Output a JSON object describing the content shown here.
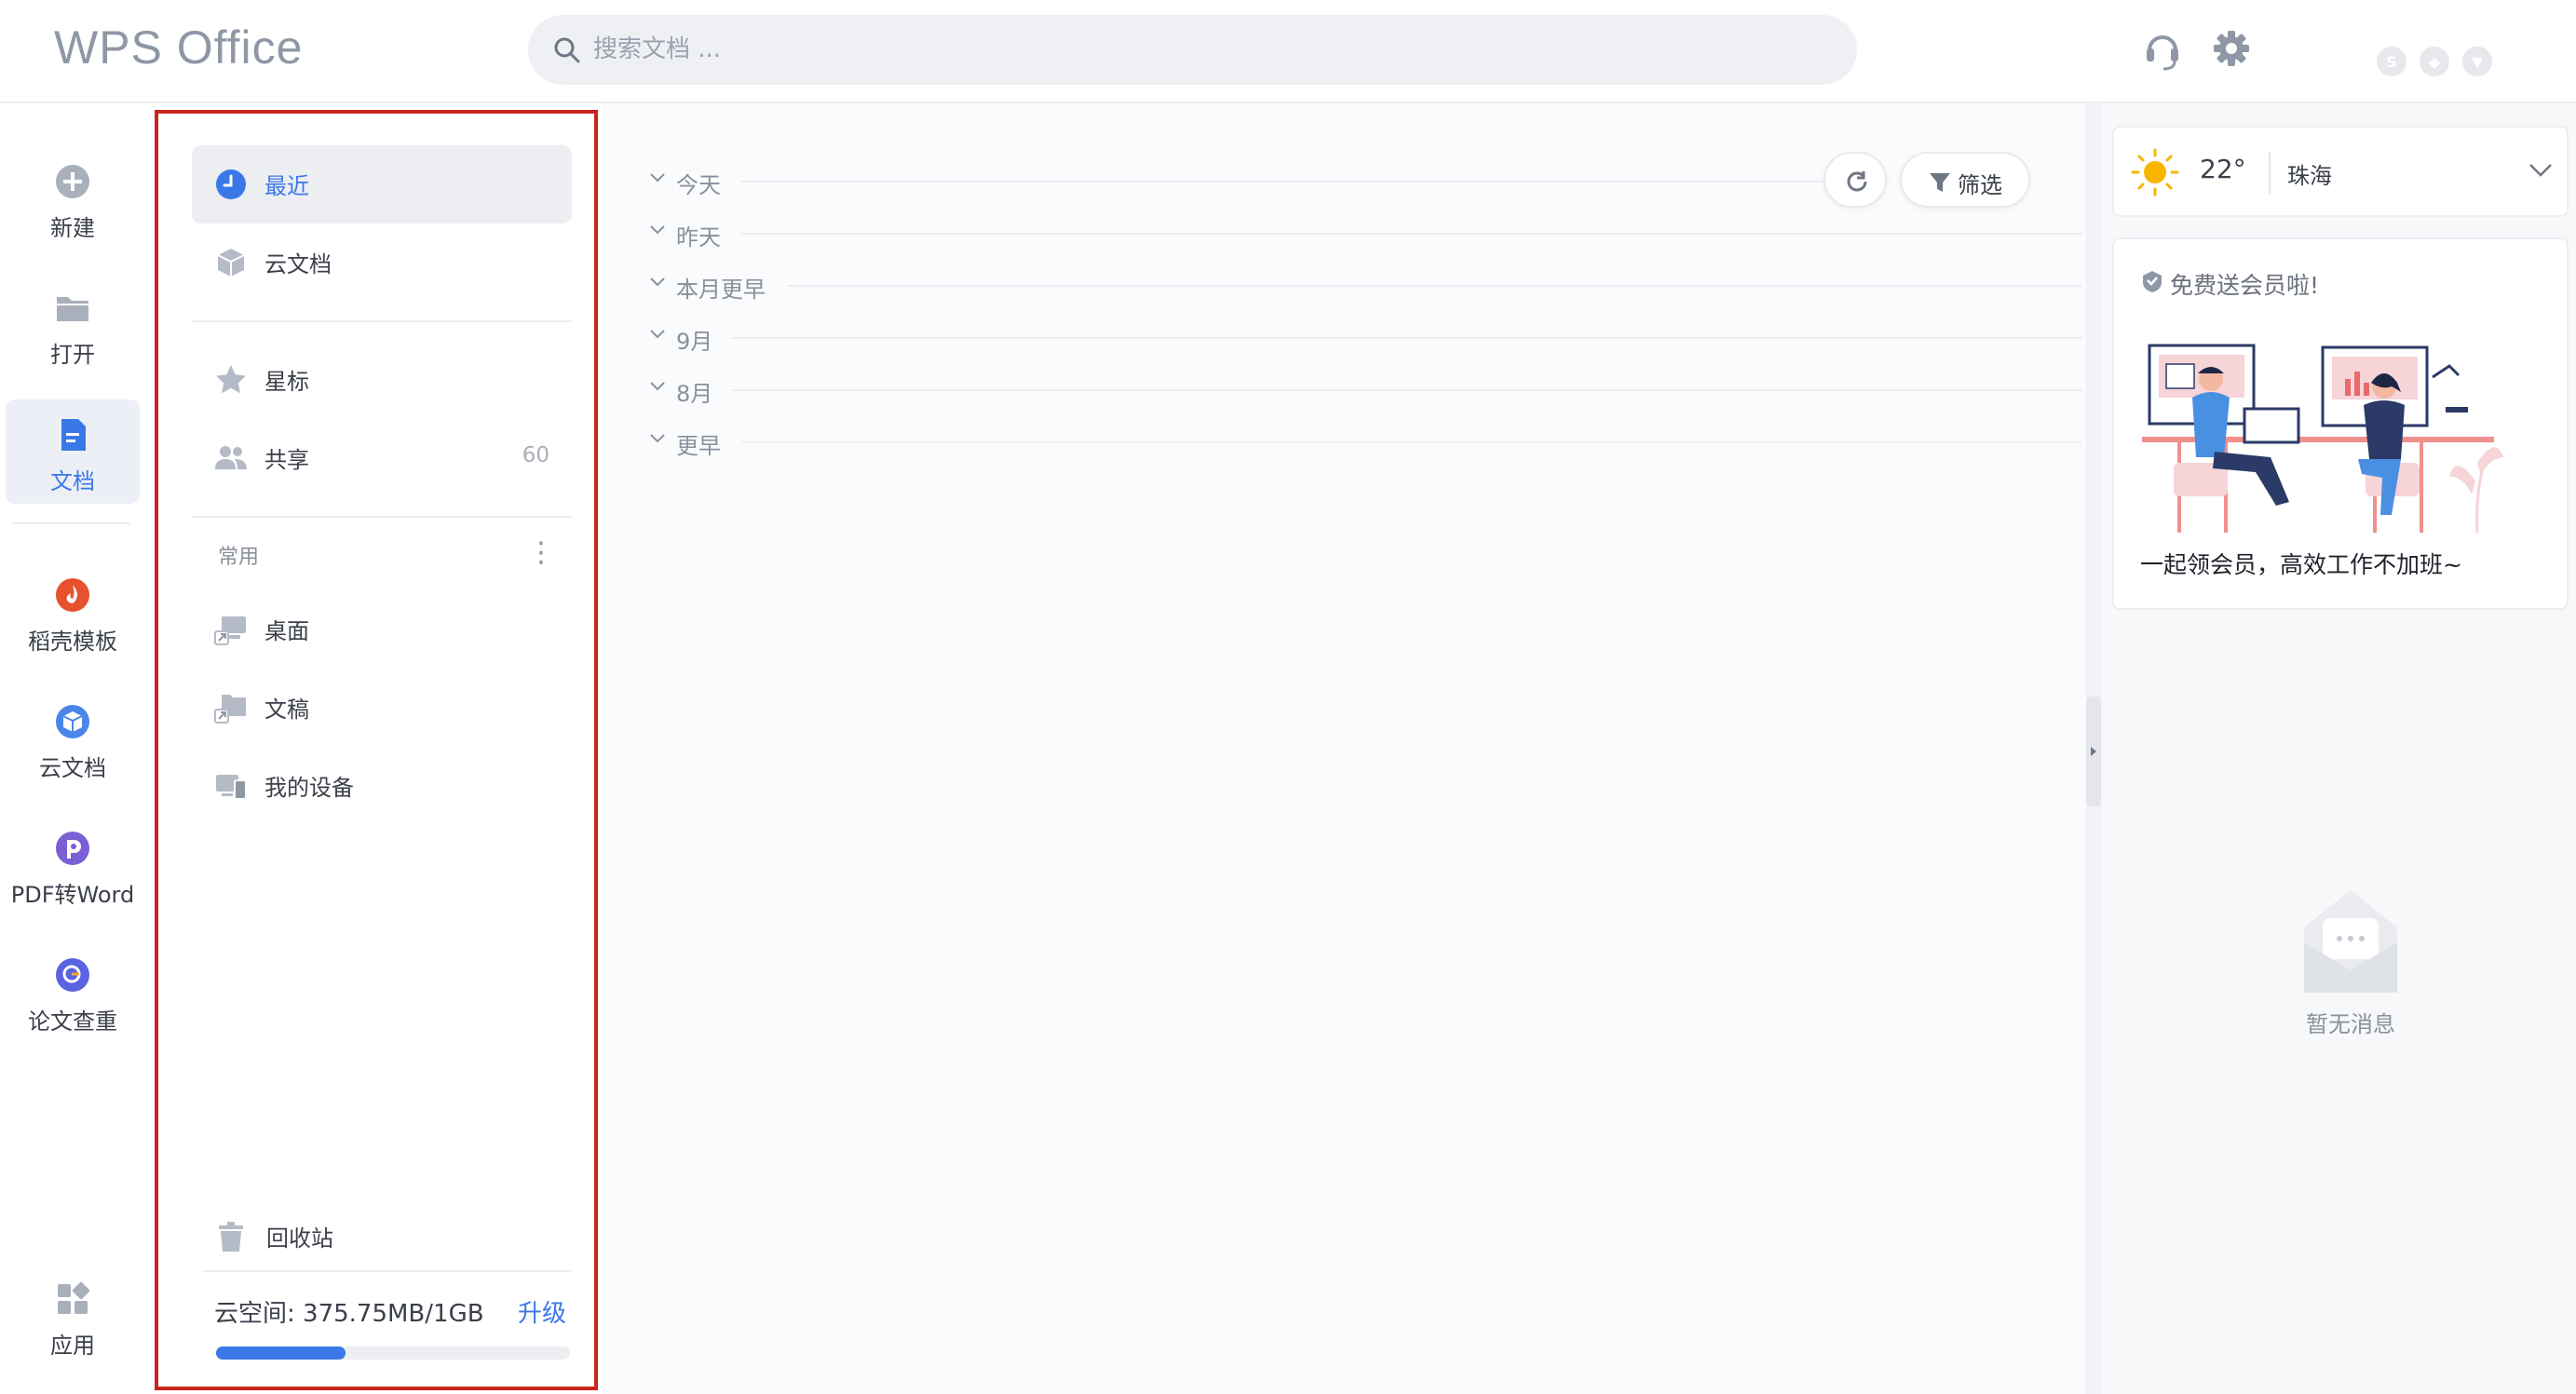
{
  "app": {
    "title": "WPS Office"
  },
  "search": {
    "placeholder": "搜索文档 ..."
  },
  "rail": {
    "items": [
      {
        "label": "新建"
      },
      {
        "label": "打开"
      },
      {
        "label": "文档"
      },
      {
        "label": "稻壳模板"
      },
      {
        "label": "云文档"
      },
      {
        "label": "PDF转Word"
      },
      {
        "label": "论文查重"
      },
      {
        "label": "应用"
      }
    ],
    "active": "文档"
  },
  "nav": {
    "items": [
      {
        "label": "最近"
      },
      {
        "label": "云文档"
      },
      {
        "label": "星标"
      },
      {
        "label": "共享",
        "count": "60"
      }
    ],
    "section_label": "常用",
    "favorites": [
      {
        "label": "桌面"
      },
      {
        "label": "文稿"
      },
      {
        "label": "我的设备"
      }
    ],
    "trash_label": "回收站",
    "storage_text": "云空间: 375.75MB/1GB",
    "upgrade_label": "升级",
    "storage_used_fraction": 0.367
  },
  "main": {
    "groups": [
      "今天",
      "昨天",
      "本月更早",
      "9月",
      "8月",
      "更早"
    ],
    "filter_label": "筛选"
  },
  "weather": {
    "temp": "22°",
    "city": "珠海"
  },
  "promo": {
    "header": "免费送会员啦!",
    "caption": "一起领会员，高效工作不加班~"
  },
  "messages": {
    "empty_text": "暂无消息"
  },
  "colors": {
    "accent": "#3b78e7",
    "highlight_border": "#c9241e"
  }
}
